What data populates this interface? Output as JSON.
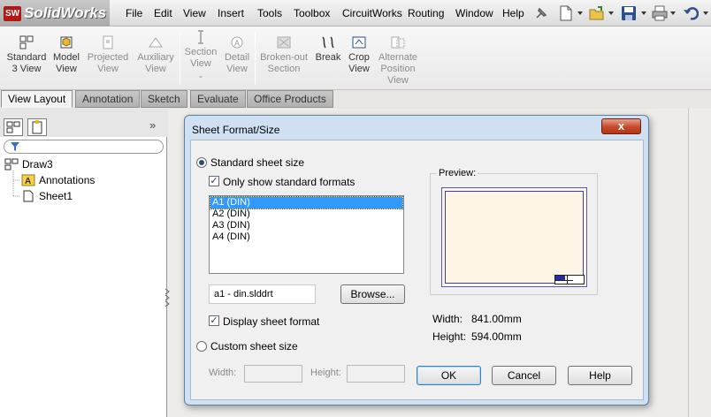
{
  "app": {
    "logo_text": "SolidWorks",
    "logo_mark": "SW"
  },
  "menu": [
    "File",
    "Edit",
    "View",
    "Insert",
    "Tools",
    "Toolbox",
    "CircuitWorks",
    "Routing",
    "Window",
    "Help"
  ],
  "quick_toolbar": [
    "pin-icon",
    "new-document-icon",
    "open-folder-icon",
    "save-icon",
    "print-icon",
    "undo-icon"
  ],
  "ribbon": {
    "buttons": [
      {
        "line1": "Standard",
        "line2": "3 View",
        "line3": "",
        "enabled": true,
        "icon": "standard-3-view-icon"
      },
      {
        "line1": "Model",
        "line2": "View",
        "line3": "",
        "enabled": true,
        "icon": "model-view-icon"
      },
      {
        "line1": "Projected",
        "line2": "View",
        "line3": "",
        "enabled": false,
        "icon": "projected-view-icon"
      },
      {
        "line1": "Auxiliary",
        "line2": "View",
        "line3": "",
        "enabled": false,
        "icon": "auxiliary-view-icon"
      },
      {
        "line1": "Section",
        "line2": "View",
        "line3": "",
        "enabled": false,
        "icon": "section-view-icon"
      },
      {
        "line1": "Detail",
        "line2": "View",
        "line3": "",
        "enabled": false,
        "icon": "detail-view-icon"
      },
      {
        "line1": "Broken-out",
        "line2": "Section",
        "line3": "",
        "enabled": false,
        "icon": "broken-out-section-icon"
      },
      {
        "line1": "Break",
        "line2": "",
        "line3": "",
        "enabled": true,
        "icon": "break-icon"
      },
      {
        "line1": "Crop",
        "line2": "View",
        "line3": "",
        "enabled": true,
        "icon": "crop-view-icon"
      },
      {
        "line1": "Alternate",
        "line2": "Position",
        "line3": "View",
        "enabled": false,
        "icon": "alternate-position-view-icon"
      }
    ]
  },
  "tabs": [
    {
      "label": "View Layout",
      "active": true
    },
    {
      "label": "Annotation",
      "active": false
    },
    {
      "label": "Sketch",
      "active": false
    },
    {
      "label": "Evaluate",
      "active": false
    },
    {
      "label": "Office Products",
      "active": false
    }
  ],
  "tree": {
    "expand_symbol": "»",
    "items": [
      {
        "label": "Draw3",
        "icon": "drawing-icon"
      },
      {
        "label": "Annotations",
        "icon": "annotations-icon"
      },
      {
        "label": "Sheet1",
        "icon": "sheet-icon"
      }
    ]
  },
  "dialog": {
    "title": "Sheet Format/Size",
    "close_symbol": "x",
    "standard_size_label": "Standard sheet size",
    "standard_size_selected": true,
    "only_standard_label": "Only show standard formats",
    "only_standard_checked": true,
    "formats": [
      "A1 (DIN)",
      "A2 (DIN)",
      "A3 (DIN)",
      "A4 (DIN)"
    ],
    "selected_format": "A1 (DIN)",
    "file_name": "a1 - din.slddrt",
    "browse_label": "Browse...",
    "display_format_label": "Display sheet format",
    "display_format_checked": true,
    "custom_size_label": "Custom sheet size",
    "custom_size_selected": false,
    "width_label": "Width:",
    "height_label": "Height:",
    "preview_label": "Preview:",
    "preview_width_label": "Width:",
    "preview_width_value": "841.00mm",
    "preview_height_label": "Height:",
    "preview_height_value": "594.00mm",
    "ok_label": "OK",
    "cancel_label": "Cancel",
    "help_label": "Help",
    "check_mark": "✓"
  }
}
